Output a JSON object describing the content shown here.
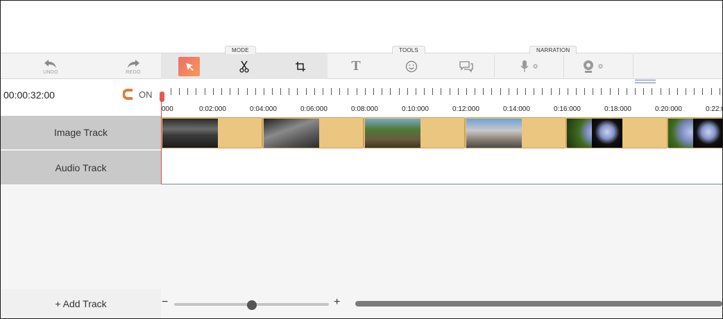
{
  "toolbar": {
    "undo_label": "UNDO",
    "redo_label": "REDO",
    "mode_group": "MODE",
    "tools_group": "TOOLS",
    "narration_group": "NARRATION",
    "text_tool_glyph": "T"
  },
  "timeline": {
    "timecode": "00:00:32:00",
    "snap_state": "ON",
    "ruler_labels": [
      "000",
      "0:02:000",
      "0:04:000",
      "0:06:000",
      "0:08:000",
      "0:10:000",
      "0:12:000",
      "0:14:000",
      "0:16:000",
      "0:18:000",
      "0:20:000",
      "0:22:0"
    ],
    "tracks": [
      {
        "name": "Image Track"
      },
      {
        "name": "Audio Track"
      }
    ]
  },
  "bottom": {
    "add_track_label": "+ Add Track",
    "zoom_minus": "−",
    "zoom_plus": "+",
    "zoom_level": 0.5
  },
  "colors": {
    "accent_start": "#f06d6d",
    "accent_end": "#f29a56",
    "clip_fill": "#ebc681",
    "playhead": "#e04a4a"
  }
}
